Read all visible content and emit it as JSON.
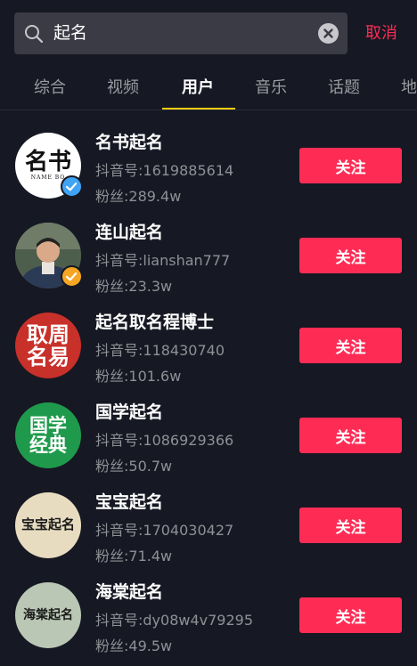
{
  "search": {
    "query": "起名",
    "cancel_label": "取消"
  },
  "tabs": [
    {
      "label": "综合"
    },
    {
      "label": "视频"
    },
    {
      "label": "用户"
    },
    {
      "label": "音乐"
    },
    {
      "label": "话题"
    },
    {
      "label": "地"
    }
  ],
  "active_tab": "用户",
  "users": [
    {
      "name": "名书起名",
      "id": "抖音号:1619885614",
      "fans": "粉丝:289.4w",
      "follow": "关注",
      "avatar_text_1": "名书",
      "avatar_text_2": "NAME BO",
      "avatar_bg": "#ffffff",
      "avatar_fg": "#111111",
      "badge": "blue-verified-icon",
      "badge_color": "#3fa4f5"
    },
    {
      "name": "连山起名",
      "id": "抖音号:lianshan777",
      "fans": "粉丝:23.3w",
      "follow": "关注",
      "avatar_bg": "#5a6a58",
      "badge": "yellow-verified-icon",
      "badge_color": "#f6a623"
    },
    {
      "name": "起名取名程博士",
      "id": "抖音号:118430740",
      "fans": "粉丝:101.6w",
      "follow": "关注",
      "avatar_text_1": "取周",
      "avatar_text_2": "名易",
      "avatar_bg": "#c8302a",
      "avatar_fg": "#ffffff"
    },
    {
      "name": "国学起名",
      "id": "抖音号:1086929366",
      "fans": "粉丝:50.7w",
      "follow": "关注",
      "avatar_text_1": "国学",
      "avatar_text_2": "经典",
      "avatar_bg": "#1f9a4c",
      "avatar_fg": "#ffffff"
    },
    {
      "name": "宝宝起名",
      "id": "抖音号:1704030427",
      "fans": "粉丝:71.4w",
      "follow": "关注",
      "avatar_text_1": "宝宝起名",
      "avatar_bg": "#e8dcc0",
      "avatar_fg": "#1a1a1a"
    },
    {
      "name": "海棠起名",
      "id": "抖音号:dy08w4v79295",
      "fans": "粉丝:49.5w",
      "follow": "关注",
      "avatar_text_1": "海棠起名",
      "avatar_bg": "#b9c7b4",
      "avatar_fg": "#1a1a1a"
    }
  ],
  "colors": {
    "accent": "#fe2c55",
    "tab_indicator": "#face15",
    "background": "#161823"
  }
}
